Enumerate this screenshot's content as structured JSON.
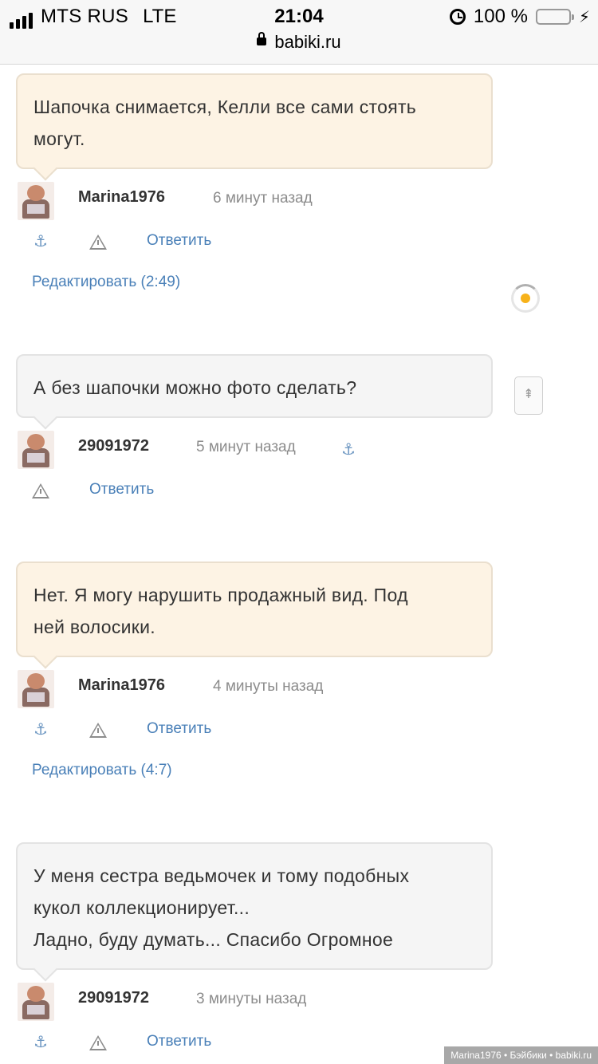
{
  "status_bar": {
    "carrier": "MTS RUS",
    "network": "LTE",
    "time": "21:04",
    "battery_percent": "100 %",
    "url": "babiki.ru",
    "signal_bars": 4,
    "battery_color": "#4cd964"
  },
  "comments": [
    {
      "text_lines": [
        "Шапочка снимается, Келли все сами стоять",
        "могут."
      ],
      "author": "Marina1976",
      "time": "6 минут назад",
      "reply_label": "Ответить",
      "edit_label": "Редактировать (2:49)",
      "is_owner": true
    },
    {
      "text_lines": [
        "А без шапочки можно фото сделать?"
      ],
      "author": "29091972",
      "time": "5 минут назад",
      "reply_label": "Ответить",
      "is_owner": false
    },
    {
      "text_lines": [
        "Нет. Я могу нарушить продажный вид. Под",
        "ней волосики."
      ],
      "author": "Marina1976",
      "time": "4 минуты назад",
      "reply_label": "Ответить",
      "edit_label": "Редактировать (4:7)",
      "is_owner": true
    },
    {
      "text_lines": [
        "У меня сестра ведьмочек и тому подобных",
        "кукол коллекционирует...",
        "Ладно, буду думать... Спасибо Огромное"
      ],
      "author": "29091972",
      "time": "3 минуты назад",
      "reply_label": "Ответить",
      "is_owner": false
    }
  ],
  "footer": {
    "credit": "Marina1976 • Бэйбики • babiki.ru"
  },
  "icons": {
    "anchor": "anchor-icon",
    "report": "warning-icon",
    "scroll_top": "scroll-top-icon",
    "loading": "loading-spinner-icon"
  },
  "colors": {
    "owner_bubble": "#fdf3e4",
    "guest_bubble": "#f5f5f5",
    "link": "#4a80b8"
  }
}
